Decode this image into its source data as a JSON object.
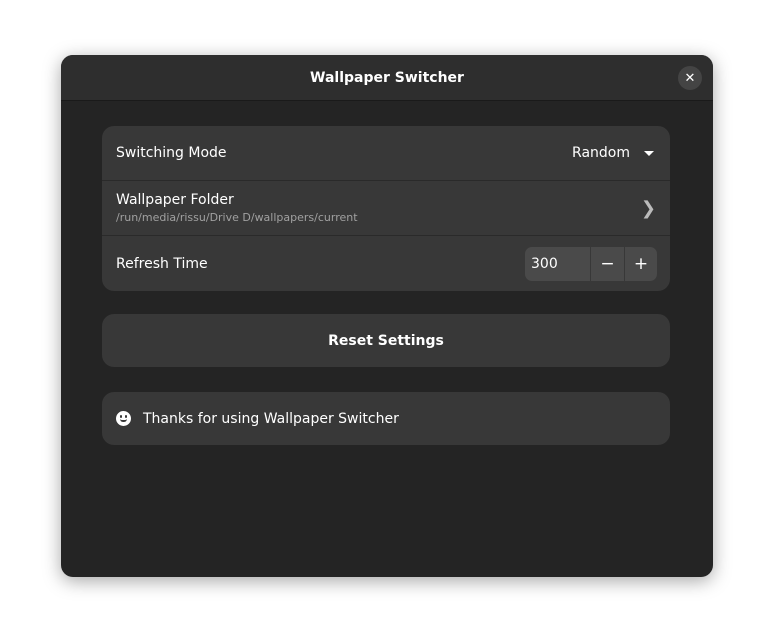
{
  "window": {
    "title": "Wallpaper Switcher",
    "close_icon": "close-icon"
  },
  "settings": {
    "switching_mode": {
      "label": "Switching Mode",
      "value": "Random"
    },
    "wallpaper_folder": {
      "label": "Wallpaper Folder",
      "path": "/run/media/rissu/Drive D/wallpapers/current"
    },
    "refresh_time": {
      "label": "Refresh Time",
      "value": "300",
      "decrement": "−",
      "increment": "+"
    }
  },
  "reset_button": "Reset Settings",
  "message": "Thanks for using Wallpaper Switcher"
}
